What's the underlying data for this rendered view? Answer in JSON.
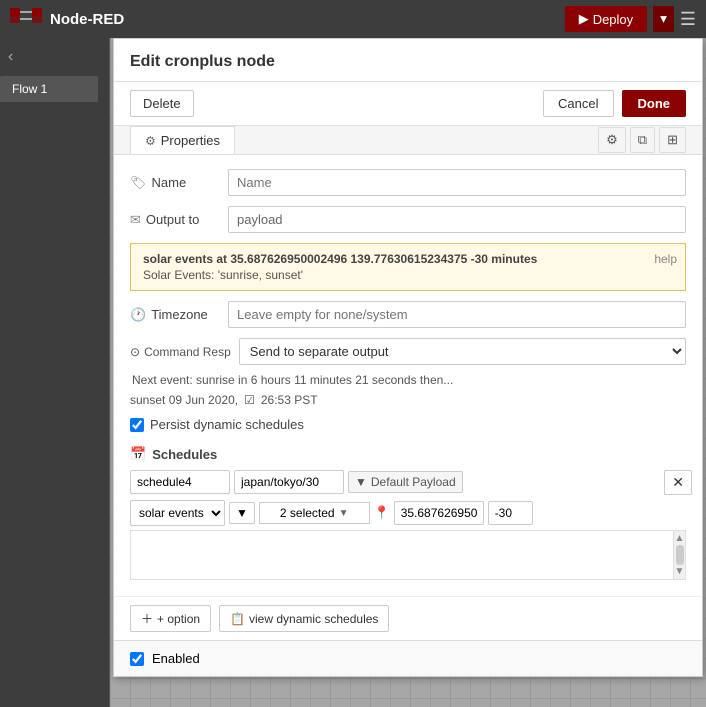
{
  "topbar": {
    "title": "Node-RED",
    "deploy_label": "Deploy",
    "menu_icon": "☰"
  },
  "sidebar": {
    "tab_label": "Flow 1"
  },
  "dialog": {
    "title": "Edit cronplus node",
    "delete_label": "Delete",
    "cancel_label": "Cancel",
    "done_label": "Done",
    "tabs": {
      "properties_label": "Properties",
      "icon": "⚙"
    },
    "form": {
      "name_label": "Name",
      "name_placeholder": "Name",
      "output_label": "Output to",
      "output_value": "payload",
      "timezone_label": "Timezone",
      "timezone_placeholder": "Leave empty for none/system",
      "solar_info": "solar events at  35.687626950002496 139.77630615234375 -30 minutes",
      "help_label": "help",
      "solar_events_label": "Solar Events: 'sunrise, sunset'",
      "command_resp_label": "Command Resp",
      "command_resp_option": "Send to separate output",
      "next_event_text": "Next event: sunrise in 6 hours 11 minutes 21 seconds then...",
      "sunset_text": "sunset 09 Jun 2020,",
      "sunset_time": "26:53 PST",
      "persist_label": "Persist dynamic schedules",
      "schedules_label": "Schedules",
      "schedule": {
        "name": "schedule4",
        "timezone": "japan/tokyo/30",
        "payload_label": "Default Payload",
        "type": "solar events",
        "selected_text": "2 selected",
        "lat": "35.6876269500",
        "lon": "-30"
      },
      "add_option_label": "+ option",
      "view_schedules_label": "view dynamic schedules"
    },
    "enabled_label": "Enabled"
  }
}
